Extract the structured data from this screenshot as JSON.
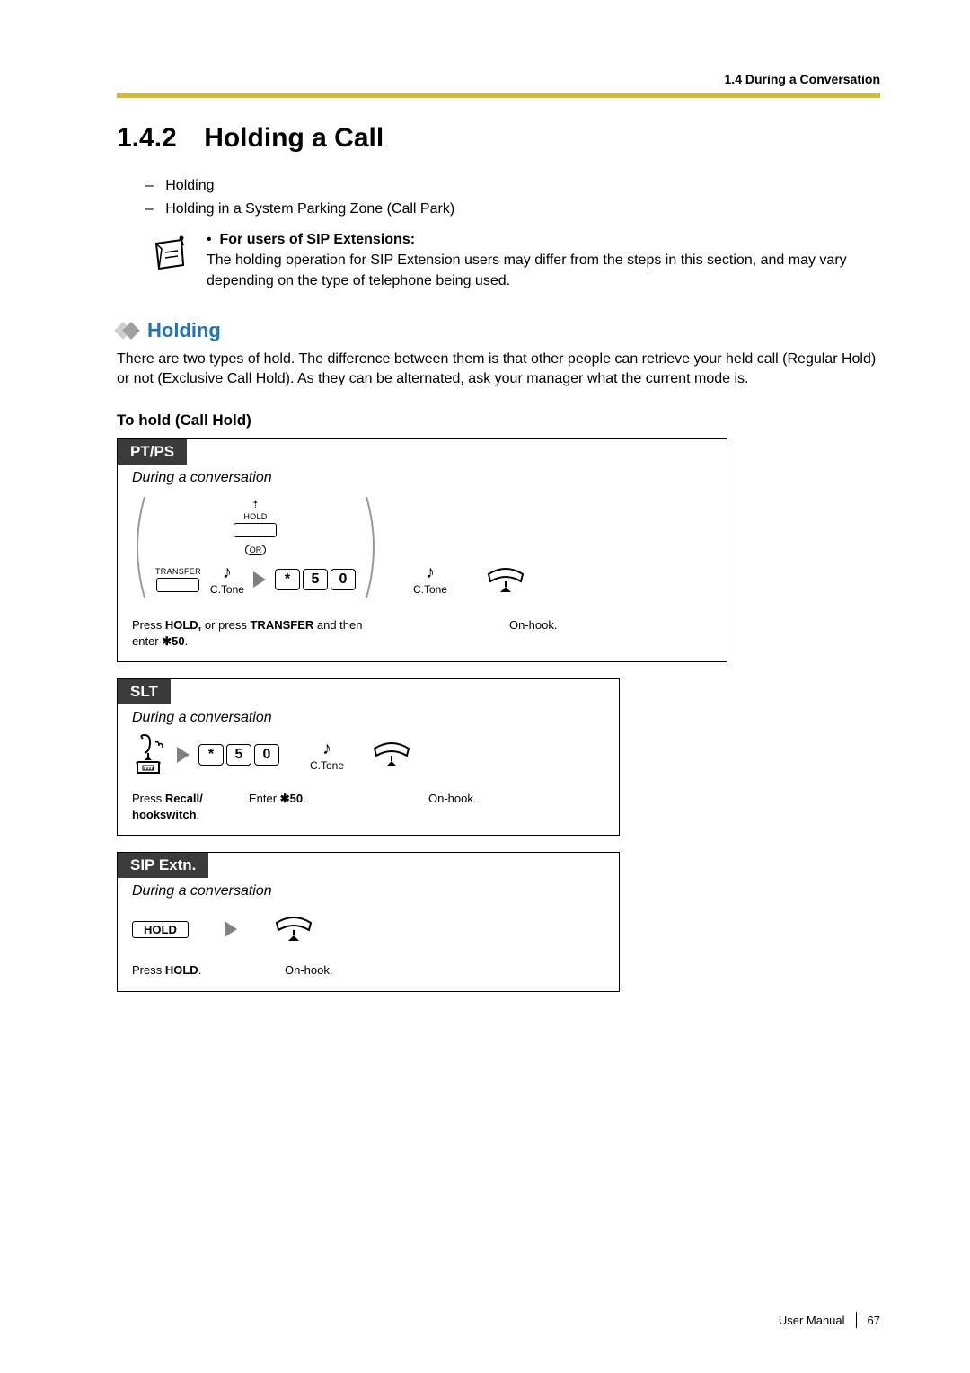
{
  "header": {
    "breadcrumb": "1.4 During a Conversation"
  },
  "section": {
    "number": "1.4.2",
    "title": "Holding a Call"
  },
  "bullets": {
    "item1": "Holding",
    "item2": "Holding in a System Parking Zone (Call Park)"
  },
  "note": {
    "bullet_label": "For users of SIP Extensions:",
    "text": "The holding operation for SIP Extension users may differ from the steps in this section, and may vary depending on the type of telephone being used."
  },
  "subheading": "Holding",
  "body": "There are two types of hold. The difference between them is that other people can retrieve your held call (Regular Hold) or not (Exclusive Call Hold). As they can be alternated, ask your manager what the current mode is.",
  "instr_title": "To hold (Call Hold)",
  "proc_ptps": {
    "tab": "PT/PS",
    "sub": "During a conversation",
    "hold_label": "HOLD",
    "or_label": "OR",
    "transfer_label": "TRANSFER",
    "ctone1": "C.Tone",
    "star": "*",
    "d1": "5",
    "d2": "0",
    "ctone2": "C.Tone",
    "caption_pre": "Press ",
    "caption_b1": "HOLD, ",
    "caption_mid": "or press ",
    "caption_b2": "TRANSFER ",
    "caption_post1": "and then enter ",
    "caption_code": "50",
    "caption_dot": ".",
    "onhook": "On-hook."
  },
  "proc_slt": {
    "tab": "SLT",
    "sub": "During a conversation",
    "star": "*",
    "d1": "5",
    "d2": "0",
    "ctone": "C.Tone",
    "cap1_pre": "Press ",
    "cap1_b": "Recall/\nhookswitch",
    "cap1_dot": ".",
    "cap2_pre": "Enter ",
    "cap2_code": "50",
    "cap2_dot": ".",
    "onhook": "On-hook."
  },
  "proc_sip": {
    "tab": "SIP Extn.",
    "sub": "During a conversation",
    "hold_btn": "HOLD",
    "cap1_pre": "Press ",
    "cap1_b": "HOLD",
    "cap1_dot": ".",
    "onhook": "On-hook."
  },
  "footer": {
    "label": "User Manual",
    "page": "67"
  }
}
